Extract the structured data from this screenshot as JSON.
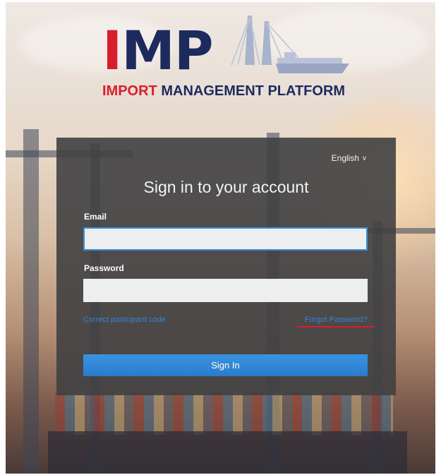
{
  "logo": {
    "letter_i": "I",
    "letters_mp": "MP",
    "tag_red": "IMPORT",
    "tag_navy": "MANAGEMENT PLATFORM"
  },
  "language": {
    "selected": "English",
    "chevron": "v"
  },
  "form": {
    "title": "Sign in to your account",
    "email_label": "Email",
    "email_value": "",
    "password_label": "Password",
    "password_value": "",
    "participant_link": "Correct participant code",
    "forgot_link": "Forgot Password?",
    "signin_button": "Sign In"
  },
  "colors": {
    "brand_red": "#d81e2c",
    "brand_navy": "#1c2a5e",
    "link_blue": "#2f86d9",
    "card_bg": "#404042"
  }
}
